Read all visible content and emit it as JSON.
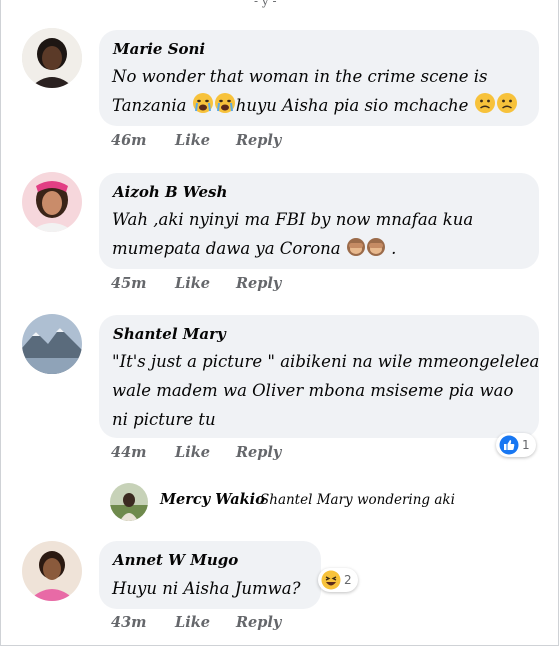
{
  "comments": [
    {
      "author": "Marie Soni",
      "line1": "No wonder that woman in the crime scene is",
      "line2": "Tanzania",
      "line2b": "huyu Aisha pia sio mchache",
      "time": "46m",
      "like": "Like",
      "reply": "Reply",
      "emojis": [
        "crying-face",
        "crying-face",
        "sad-face",
        "sad-face"
      ]
    },
    {
      "author": "Aizoh B Wesh",
      "line1": "Wah ,aki nyinyi ma FBI by now mnafaa kua",
      "line2": "mumepata dawa ya Corona",
      "line2b": ".",
      "time": "45m",
      "like": "Like",
      "reply": "Reply",
      "emojis": [
        "see-no-evil-monkey",
        "see-no-evil-monkey"
      ]
    },
    {
      "author": "Shantel Mary",
      "line1": "\"It's just a picture \" aibikeni na wile mmeongelelea",
      "line2": "wale madem wa Oliver  mbona msiseme pia wao",
      "line3": "ni picture tu",
      "time": "44m",
      "like": "Like",
      "reply": "Reply",
      "reaction": {
        "type": "like",
        "count": "1"
      }
    },
    {
      "author": "Annet W Mugo",
      "line1": "Huyu ni Aisha Jumwa?",
      "time": "43m",
      "like": "Like",
      "reply": "Reply",
      "reaction": {
        "type": "haha",
        "count": "2"
      }
    }
  ],
  "reply": {
    "author": "Mercy Wakio",
    "text": "Shantel Mary wondering aki"
  },
  "colors": {
    "bubble": "#f0f2f5",
    "meta": "#65676b",
    "like_blue": "#1877f2"
  }
}
